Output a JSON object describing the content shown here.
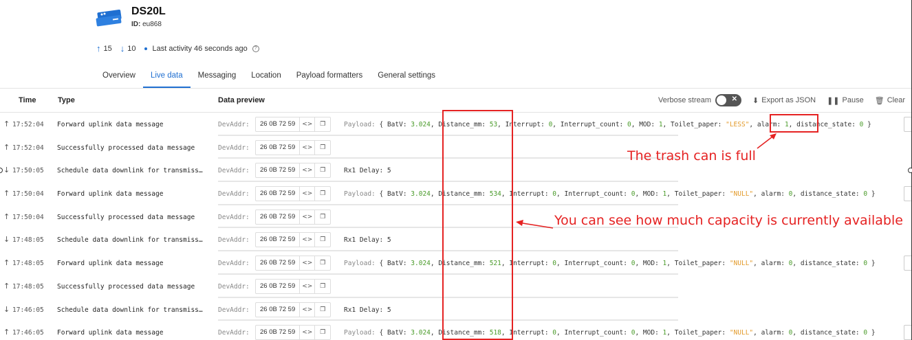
{
  "device": {
    "name": "DS20L",
    "id_label": "ID:",
    "id_value": "eu868"
  },
  "stats": {
    "up_count": "15",
    "down_count": "10",
    "last_activity": "Last activity 46 seconds ago"
  },
  "tabs": [
    "Overview",
    "Live data",
    "Messaging",
    "Location",
    "Payload formatters",
    "General settings"
  ],
  "active_tab": "Live data",
  "columns": {
    "time": "Time",
    "type": "Type",
    "preview": "Data preview"
  },
  "toolbar": {
    "verbose_label": "Verbose stream",
    "export_label": "Export as JSON",
    "pause_label": "Pause",
    "clear_label": "Clear"
  },
  "devaddr_label": "DevAddr:",
  "rows": [
    {
      "dir": "up",
      "time": "17:52:04",
      "type": "Forward uplink data message",
      "addr": "26 0B 72 59",
      "kind": "payload",
      "payload": {
        "BatV": "3.024",
        "Distance_mm": "53",
        "Interrupt": "0",
        "Interrupt_count": "0",
        "MOD": "1",
        "Toilet_paper": "\"LESS\"",
        "alarm": "1",
        "distance_state": "0"
      }
    },
    {
      "dir": "up",
      "time": "17:52:04",
      "type": "Successfully processed data message",
      "addr": "26 0B 72 59",
      "kind": "none"
    },
    {
      "dir": "down",
      "time": "17:50:05",
      "type": "Schedule data downlink for transmiss…",
      "addr": "26 0B 72 59",
      "kind": "rx1",
      "rx1": "Rx1 Delay: 5"
    },
    {
      "dir": "up",
      "time": "17:50:04",
      "type": "Forward uplink data message",
      "addr": "26 0B 72 59",
      "kind": "payload",
      "payload": {
        "BatV": "3.024",
        "Distance_mm": "534",
        "Interrupt": "0",
        "Interrupt_count": "0",
        "MOD": "1",
        "Toilet_paper": "\"NULL\"",
        "alarm": "0",
        "distance_state": "0"
      }
    },
    {
      "dir": "up",
      "time": "17:50:04",
      "type": "Successfully processed data message",
      "addr": "26 0B 72 59",
      "kind": "none"
    },
    {
      "dir": "down",
      "time": "17:48:05",
      "type": "Schedule data downlink for transmiss…",
      "addr": "26 0B 72 59",
      "kind": "rx1",
      "rx1": "Rx1 Delay: 5"
    },
    {
      "dir": "up",
      "time": "17:48:05",
      "type": "Forward uplink data message",
      "addr": "26 0B 72 59",
      "kind": "payload",
      "payload": {
        "BatV": "3.024",
        "Distance_mm": "521",
        "Interrupt": "0",
        "Interrupt_count": "0",
        "MOD": "1",
        "Toilet_paper": "\"NULL\"",
        "alarm": "0",
        "distance_state": "0"
      }
    },
    {
      "dir": "up",
      "time": "17:48:05",
      "type": "Successfully processed data message",
      "addr": "26 0B 72 59",
      "kind": "none"
    },
    {
      "dir": "down",
      "time": "17:46:05",
      "type": "Schedule data downlink for transmiss…",
      "addr": "26 0B 72 59",
      "kind": "rx1",
      "rx1": "Rx1 Delay: 5"
    },
    {
      "dir": "up",
      "time": "17:46:05",
      "type": "Forward uplink data message",
      "addr": "26 0B 72 59",
      "kind": "payload",
      "payload": {
        "BatV": "3.024",
        "Distance_mm": "518",
        "Interrupt": "0",
        "Interrupt_count": "0",
        "MOD": "1",
        "Toilet_paper": "\"NULL\"",
        "alarm": "0",
        "distance_state": "0"
      }
    }
  ],
  "annotations": {
    "full_text": "The trash can is full",
    "capacity_text": "You can see how much capacity is currently available",
    "color": "#e52222"
  },
  "colors": {
    "accent": "#1f6fd1",
    "number": "#4a9b2a",
    "string": "#e39a2a"
  }
}
